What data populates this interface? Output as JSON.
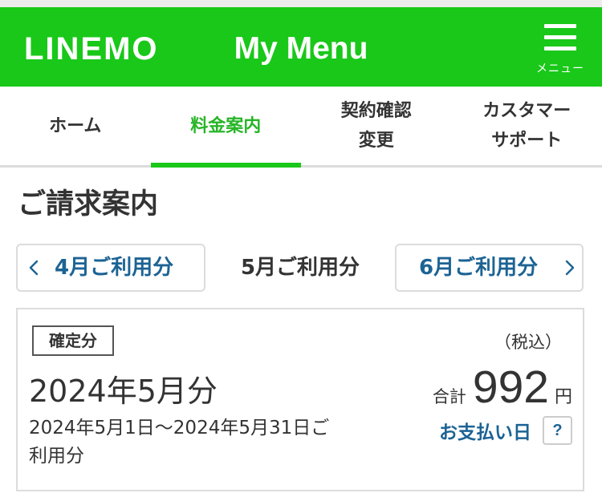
{
  "header": {
    "logo": "LINEMO",
    "title": "My Menu",
    "menu_label": "メニュー"
  },
  "tabs": [
    {
      "label": "ホーム",
      "active": false
    },
    {
      "label": "料金案内",
      "active": true
    },
    {
      "label": "契約確認\n変更",
      "active": false
    },
    {
      "label": "カスタマー\nサポート",
      "active": false
    }
  ],
  "section_title": "ご請求案内",
  "month_nav": {
    "prev": "4月ご利用分",
    "current": "5月ご利用分",
    "next": "6月ご利用分"
  },
  "bill": {
    "status_badge": "確定分",
    "tax_note": "（税込）",
    "period_title": "2024年5月分",
    "total_label": "合計",
    "total_amount": "992",
    "currency": "円",
    "period_range": "2024年5月1日〜2024年5月31日ご利用分",
    "payment_date_label": "お支払い日",
    "help_label": "?"
  },
  "colors": {
    "brand_green": "#19c819",
    "active_tab": "#27b527",
    "link_blue": "#1c6394",
    "text": "#333333"
  },
  "icons": {
    "menu": "hamburger-menu-icon",
    "prev_month": "chevron-left-icon",
    "next_month": "chevron-right-icon"
  }
}
